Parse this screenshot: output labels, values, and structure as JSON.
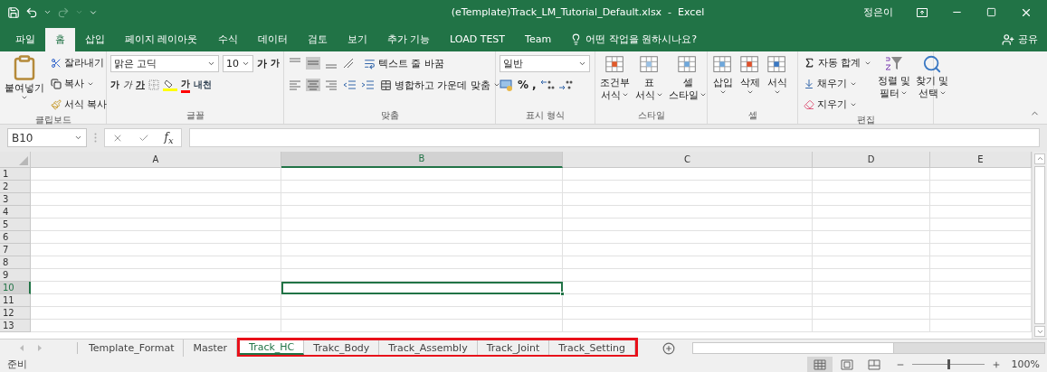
{
  "title_bar": {
    "title": "(eTemplate)Track_LM_Tutorial_Default.xlsx  -  Excel",
    "user": "정은이"
  },
  "ribbon_tabs": [
    {
      "label": "파일",
      "selected": false
    },
    {
      "label": "홈",
      "selected": true
    },
    {
      "label": "삽입",
      "selected": false
    },
    {
      "label": "페이지 레이아웃",
      "selected": false
    },
    {
      "label": "수식",
      "selected": false
    },
    {
      "label": "데이터",
      "selected": false
    },
    {
      "label": "검토",
      "selected": false
    },
    {
      "label": "보기",
      "selected": false
    },
    {
      "label": "추가 기능",
      "selected": false
    },
    {
      "label": "LOAD TEST",
      "selected": false
    },
    {
      "label": "Team",
      "selected": false
    }
  ],
  "tell_me": {
    "placeholder": "어떤 작업을 원하시나요?"
  },
  "share": "공유",
  "ribbon": {
    "clipboard": {
      "label": "클립보드",
      "paste": "붙여넣기",
      "cut": "잘라내기",
      "copy": "복사",
      "format_painter": "서식 복사"
    },
    "font": {
      "label": "글꼴",
      "font_name": "맑은 고딕",
      "font_size": "10",
      "grow": "가",
      "shrink": "가",
      "bold": "가",
      "italic": "가",
      "underline": "가",
      "font_color": "가",
      "phonetic": "내천"
    },
    "alignment": {
      "label": "맞춤",
      "wrap_text": "텍스트 줄 바꿈",
      "merge": "병합하고 가운데 맞춤"
    },
    "number": {
      "label": "표시 형식",
      "format": "일반",
      "percent": "%",
      "comma": ","
    },
    "styles": {
      "label": "스타일",
      "buttons": [
        {
          "line1": "조건부",
          "line2": "서식"
        },
        {
          "line1": "표",
          "line2": "서식"
        },
        {
          "line1": "셀",
          "line2": "스타일"
        }
      ]
    },
    "cells": {
      "label": "셀",
      "buttons": [
        "삽입",
        "삭제",
        "서식"
      ]
    },
    "editing": {
      "label": "편집",
      "autosum": "자동 합계",
      "fill": "채우기",
      "clear": "지우기",
      "sort": {
        "line1": "정렬 및",
        "line2": "필터"
      },
      "find": {
        "line1": "찾기 및",
        "line2": "선택"
      }
    }
  },
  "formula_bar": {
    "name_box": "B10",
    "fx": "f$_{x}$"
  },
  "columns": [
    {
      "label": "A",
      "selected": false
    },
    {
      "label": "B",
      "selected": true
    },
    {
      "label": "C",
      "selected": false
    },
    {
      "label": "D",
      "selected": false
    },
    {
      "label": "E",
      "selected": false
    }
  ],
  "rows": [
    {
      "label": "1",
      "selected": false
    },
    {
      "label": "2",
      "selected": false
    },
    {
      "label": "3",
      "selected": false
    },
    {
      "label": "4",
      "selected": false
    },
    {
      "label": "5",
      "selected": false
    },
    {
      "label": "6",
      "selected": false
    },
    {
      "label": "7",
      "selected": false
    },
    {
      "label": "8",
      "selected": false
    },
    {
      "label": "9",
      "selected": false
    },
    {
      "label": "10",
      "selected": true
    },
    {
      "label": "11",
      "selected": false
    },
    {
      "label": "12",
      "selected": false
    },
    {
      "label": "13",
      "selected": false
    }
  ],
  "sheet_tabs": [
    {
      "label": "Template_Format",
      "selected": false,
      "highlighted": false
    },
    {
      "label": "Master",
      "selected": false,
      "highlighted": false
    },
    {
      "label": "Track_HC",
      "selected": true,
      "highlighted": true
    },
    {
      "label": "Trakc_Body",
      "selected": false,
      "highlighted": true
    },
    {
      "label": "Track_Assembly",
      "selected": false,
      "highlighted": true
    },
    {
      "label": "Track_Joint",
      "selected": false,
      "highlighted": true
    },
    {
      "label": "Track_Setting",
      "selected": false,
      "highlighted": true
    }
  ],
  "status_bar": {
    "status": "준비",
    "views": [
      {
        "kind": "normal",
        "selected": true
      },
      {
        "kind": "page_layout",
        "selected": false
      },
      {
        "kind": "page_break",
        "selected": false
      }
    ],
    "zoom": {
      "level": 0.5,
      "reading": "100%"
    }
  }
}
